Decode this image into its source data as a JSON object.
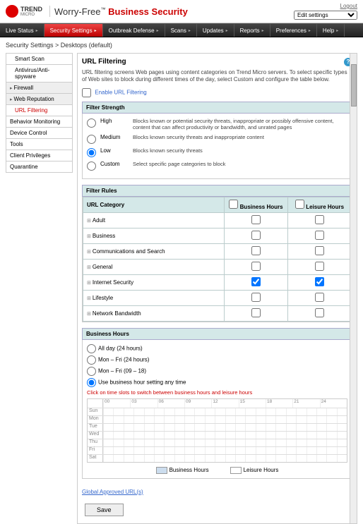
{
  "header": {
    "brand_small": "TREND",
    "brand_sub": "MICRO",
    "product_prefix": "Worry-Free",
    "product_suffix": "Business Security",
    "tm": "™",
    "logout": "Logout",
    "edit_settings": "Edit settings"
  },
  "nav": [
    {
      "label": "Live Status",
      "active": false
    },
    {
      "label": "Security Settings",
      "active": true
    },
    {
      "label": "Outbreak Defense",
      "active": false
    },
    {
      "label": "Scans",
      "active": false
    },
    {
      "label": "Updates",
      "active": false
    },
    {
      "label": "Reports",
      "active": false
    },
    {
      "label": "Preferences",
      "active": false
    },
    {
      "label": "Help",
      "active": false
    }
  ],
  "breadcrumb": "Security Settings > Desktops (default)",
  "sidebar": [
    {
      "label": "Smart Scan",
      "type": "item"
    },
    {
      "label": "Antivirus/Anti-spyware",
      "type": "item"
    },
    {
      "label": "Firewall",
      "type": "expand"
    },
    {
      "label": "Web Reputation",
      "type": "expand"
    },
    {
      "label": "URL Filtering",
      "type": "active"
    },
    {
      "label": "Behavior Monitoring",
      "type": "item"
    },
    {
      "label": "Device Control",
      "type": "item"
    },
    {
      "label": "Tools",
      "type": "item"
    },
    {
      "label": "Client Privileges",
      "type": "item"
    },
    {
      "label": "Quarantine",
      "type": "item"
    }
  ],
  "main": {
    "title": "URL Filtering",
    "desc": "URL filtering screens Web pages using content categories on Trend Micro servers. To select specific types of Web sites to block during different times of the day, select Custom and configure the table below.",
    "enable_label": "Enable URL Filtering",
    "filter_strength_title": "Filter Strength",
    "strengths": [
      {
        "key": "high",
        "label": "High",
        "desc": "Blocks known or potential security threats, inappropriate or possibly offensive content, content that can affect productivity or bandwidth, and unrated pages"
      },
      {
        "key": "medium",
        "label": "Medium",
        "desc": "Blocks known security threats and inappropriate content"
      },
      {
        "key": "low",
        "label": "Low",
        "desc": "Blocks known security threats"
      },
      {
        "key": "custom",
        "label": "Custom",
        "desc": "Select specific page categories to block"
      }
    ],
    "selected_strength": "low",
    "filter_rules_title": "Filter Rules",
    "col_category": "URL Category",
    "col_business": "Business Hours",
    "col_leisure": "Leisure Hours",
    "categories": [
      {
        "name": "Adult",
        "biz": false,
        "lei": false
      },
      {
        "name": "Business",
        "biz": false,
        "lei": false
      },
      {
        "name": "Communications and Search",
        "biz": false,
        "lei": false
      },
      {
        "name": "General",
        "biz": false,
        "lei": false
      },
      {
        "name": "Internet Security",
        "biz": true,
        "lei": true
      },
      {
        "name": "Lifestyle",
        "biz": false,
        "lei": false
      },
      {
        "name": "Network Bandwidth",
        "biz": false,
        "lei": false
      }
    ],
    "business_hours_title": "Business Hours",
    "bh_options": [
      {
        "label": "All day (24 hours)",
        "sel": false
      },
      {
        "label": "Mon – Fri (24 hours)",
        "sel": false
      },
      {
        "label": "Mon – Fri (09 – 18)",
        "sel": false
      },
      {
        "label": "Use business hour setting any time",
        "sel": true
      }
    ],
    "bh_hint": "Click on time slots to switch between business hours and leisure hours",
    "hours": [
      "00",
      "03",
      "06",
      "09",
      "12",
      "15",
      "18",
      "21",
      "24"
    ],
    "days": [
      "Sun",
      "Mon",
      "Tue",
      "Wed",
      "Thu",
      "Fri",
      "Sat"
    ],
    "legend_biz": "Business Hours",
    "legend_lei": "Leisure Hours",
    "global_link": "Global Approved URL(s)",
    "save": "Save"
  }
}
